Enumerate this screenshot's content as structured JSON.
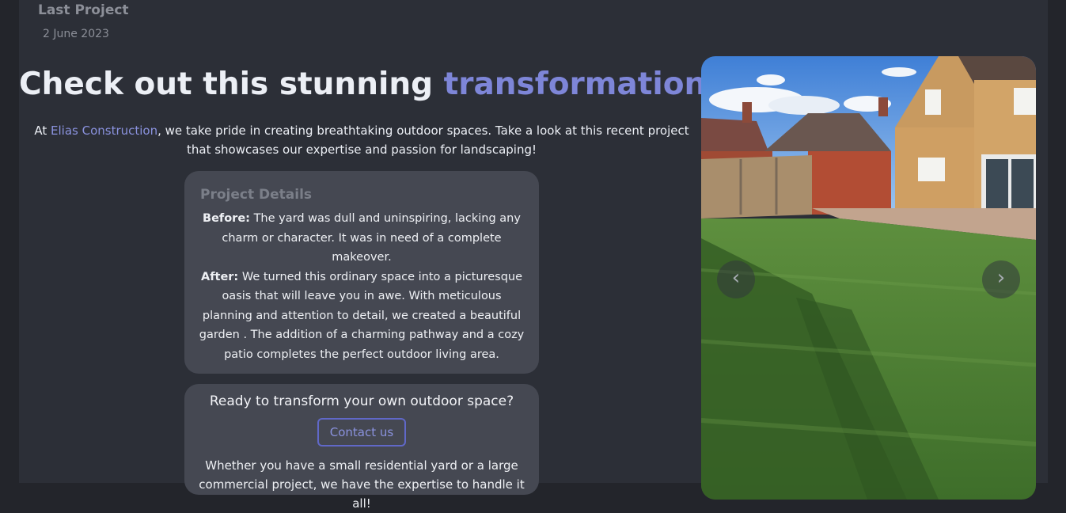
{
  "project": {
    "section_title": "Last Project",
    "date": "2 June 2023"
  },
  "headline": {
    "text_before": "Check out this stunning ",
    "accent": "transformation",
    "text_after": "!"
  },
  "intro": {
    "prefix": "At ",
    "company": "Elias Construction",
    "text": ", we take pride in creating breathtaking outdoor spaces. Take a look at this recent project that showcases our expertise and passion for landscaping!"
  },
  "details": {
    "title": "Project Details",
    "before_label": "Before:",
    "before_text": " The yard was dull and uninspiring, lacking any charm or character. It was in need of a complete makeover.",
    "after_label": "After:",
    "after_text": " We turned this ordinary space into a picturesque oasis that will leave you in awe. With meticulous planning and attention to detail, we created a beautiful garden . The addition of a charming pathway and a cozy patio completes the perfect outdoor living area."
  },
  "cta": {
    "title": "Ready to transform your own outdoor space?",
    "button_label": "Contact us",
    "body": "Whether you have a small residential yard or a large commercial project, we have the expertise to handle it all!"
  },
  "carousel": {
    "prev_icon": "‹",
    "next_icon": "›",
    "image_name": "garden-lawn-photo"
  },
  "colors": {
    "accent": "#7e86d8",
    "background": "#23252b",
    "panel": "#2c2f37",
    "card": "#454852"
  }
}
